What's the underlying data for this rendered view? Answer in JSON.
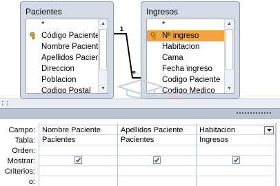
{
  "tables": [
    {
      "title": "Pacientes",
      "fields": [
        {
          "label": "*",
          "key": false,
          "selected": false
        },
        {
          "label": "Código Paciente",
          "key": true,
          "selected": false
        },
        {
          "label": "Nombre Paciente",
          "key": false,
          "selected": false
        },
        {
          "label": "Apellidos Paciente",
          "key": false,
          "selected": false
        },
        {
          "label": "Direccion",
          "key": false,
          "selected": false
        },
        {
          "label": "Poblacion",
          "key": false,
          "selected": false
        },
        {
          "label": "Codigo Postal",
          "key": false,
          "selected": false
        }
      ]
    },
    {
      "title": "Ingresos",
      "fields": [
        {
          "label": "*",
          "key": false,
          "selected": false
        },
        {
          "label": "Nº ingreso",
          "key": true,
          "selected": true
        },
        {
          "label": "Habitacion",
          "key": false,
          "selected": false
        },
        {
          "label": "Cama",
          "key": false,
          "selected": false
        },
        {
          "label": "Fecha ingreso",
          "key": false,
          "selected": false
        },
        {
          "label": "Codigo Paciente",
          "key": false,
          "selected": false
        },
        {
          "label": "Codigo Medico",
          "key": false,
          "selected": false
        }
      ]
    }
  ],
  "relationship": {
    "one_label": "1",
    "many_label": "∞"
  },
  "watermark": {
    "text": "Clic"
  },
  "grid": {
    "row_labels": {
      "field": "Campo:",
      "table": "Tabla:",
      "sort": "Orden:",
      "show": "Mostrar:",
      "criteria": "Criterios:",
      "or": "o:"
    },
    "columns": [
      {
        "field": "Nombre Paciente",
        "table": "Pacientes",
        "sort": "",
        "show": true,
        "criteria": "",
        "or": ""
      },
      {
        "field": "Apellidos Paciente",
        "table": "Pacientes",
        "sort": "",
        "show": true,
        "criteria": "",
        "or": ""
      },
      {
        "field": "Habitacion",
        "table": "Ingresos",
        "sort": "",
        "show": true,
        "criteria": "",
        "or": "",
        "has_dropdown": true
      }
    ]
  },
  "colors": {
    "selected_field": "#f2a33d",
    "table_frame": "#d4dbe5",
    "splitter": "#b9c4d2"
  },
  "icons": {
    "primary_key": "key-icon",
    "checkbox": "checkmark-icon",
    "dropdown": "chevron-down-icon"
  }
}
